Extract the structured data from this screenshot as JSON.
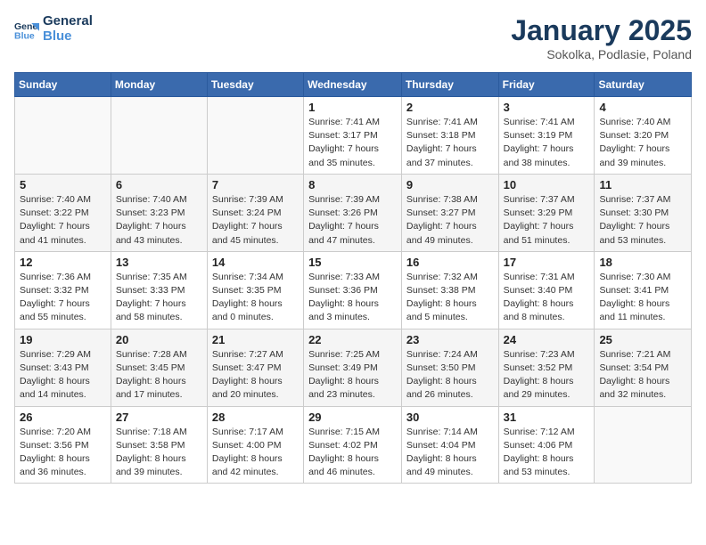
{
  "header": {
    "logo_line1": "General",
    "logo_line2": "Blue",
    "title": "January 2025",
    "subtitle": "Sokolka, Podlasie, Poland"
  },
  "weekdays": [
    "Sunday",
    "Monday",
    "Tuesday",
    "Wednesday",
    "Thursday",
    "Friday",
    "Saturday"
  ],
  "weeks": [
    [
      {
        "day": "",
        "info": ""
      },
      {
        "day": "",
        "info": ""
      },
      {
        "day": "",
        "info": ""
      },
      {
        "day": "1",
        "info": "Sunrise: 7:41 AM\nSunset: 3:17 PM\nDaylight: 7 hours and 35 minutes."
      },
      {
        "day": "2",
        "info": "Sunrise: 7:41 AM\nSunset: 3:18 PM\nDaylight: 7 hours and 37 minutes."
      },
      {
        "day": "3",
        "info": "Sunrise: 7:41 AM\nSunset: 3:19 PM\nDaylight: 7 hours and 38 minutes."
      },
      {
        "day": "4",
        "info": "Sunrise: 7:40 AM\nSunset: 3:20 PM\nDaylight: 7 hours and 39 minutes."
      }
    ],
    [
      {
        "day": "5",
        "info": "Sunrise: 7:40 AM\nSunset: 3:22 PM\nDaylight: 7 hours and 41 minutes."
      },
      {
        "day": "6",
        "info": "Sunrise: 7:40 AM\nSunset: 3:23 PM\nDaylight: 7 hours and 43 minutes."
      },
      {
        "day": "7",
        "info": "Sunrise: 7:39 AM\nSunset: 3:24 PM\nDaylight: 7 hours and 45 minutes."
      },
      {
        "day": "8",
        "info": "Sunrise: 7:39 AM\nSunset: 3:26 PM\nDaylight: 7 hours and 47 minutes."
      },
      {
        "day": "9",
        "info": "Sunrise: 7:38 AM\nSunset: 3:27 PM\nDaylight: 7 hours and 49 minutes."
      },
      {
        "day": "10",
        "info": "Sunrise: 7:37 AM\nSunset: 3:29 PM\nDaylight: 7 hours and 51 minutes."
      },
      {
        "day": "11",
        "info": "Sunrise: 7:37 AM\nSunset: 3:30 PM\nDaylight: 7 hours and 53 minutes."
      }
    ],
    [
      {
        "day": "12",
        "info": "Sunrise: 7:36 AM\nSunset: 3:32 PM\nDaylight: 7 hours and 55 minutes."
      },
      {
        "day": "13",
        "info": "Sunrise: 7:35 AM\nSunset: 3:33 PM\nDaylight: 7 hours and 58 minutes."
      },
      {
        "day": "14",
        "info": "Sunrise: 7:34 AM\nSunset: 3:35 PM\nDaylight: 8 hours and 0 minutes."
      },
      {
        "day": "15",
        "info": "Sunrise: 7:33 AM\nSunset: 3:36 PM\nDaylight: 8 hours and 3 minutes."
      },
      {
        "day": "16",
        "info": "Sunrise: 7:32 AM\nSunset: 3:38 PM\nDaylight: 8 hours and 5 minutes."
      },
      {
        "day": "17",
        "info": "Sunrise: 7:31 AM\nSunset: 3:40 PM\nDaylight: 8 hours and 8 minutes."
      },
      {
        "day": "18",
        "info": "Sunrise: 7:30 AM\nSunset: 3:41 PM\nDaylight: 8 hours and 11 minutes."
      }
    ],
    [
      {
        "day": "19",
        "info": "Sunrise: 7:29 AM\nSunset: 3:43 PM\nDaylight: 8 hours and 14 minutes."
      },
      {
        "day": "20",
        "info": "Sunrise: 7:28 AM\nSunset: 3:45 PM\nDaylight: 8 hours and 17 minutes."
      },
      {
        "day": "21",
        "info": "Sunrise: 7:27 AM\nSunset: 3:47 PM\nDaylight: 8 hours and 20 minutes."
      },
      {
        "day": "22",
        "info": "Sunrise: 7:25 AM\nSunset: 3:49 PM\nDaylight: 8 hours and 23 minutes."
      },
      {
        "day": "23",
        "info": "Sunrise: 7:24 AM\nSunset: 3:50 PM\nDaylight: 8 hours and 26 minutes."
      },
      {
        "day": "24",
        "info": "Sunrise: 7:23 AM\nSunset: 3:52 PM\nDaylight: 8 hours and 29 minutes."
      },
      {
        "day": "25",
        "info": "Sunrise: 7:21 AM\nSunset: 3:54 PM\nDaylight: 8 hours and 32 minutes."
      }
    ],
    [
      {
        "day": "26",
        "info": "Sunrise: 7:20 AM\nSunset: 3:56 PM\nDaylight: 8 hours and 36 minutes."
      },
      {
        "day": "27",
        "info": "Sunrise: 7:18 AM\nSunset: 3:58 PM\nDaylight: 8 hours and 39 minutes."
      },
      {
        "day": "28",
        "info": "Sunrise: 7:17 AM\nSunset: 4:00 PM\nDaylight: 8 hours and 42 minutes."
      },
      {
        "day": "29",
        "info": "Sunrise: 7:15 AM\nSunset: 4:02 PM\nDaylight: 8 hours and 46 minutes."
      },
      {
        "day": "30",
        "info": "Sunrise: 7:14 AM\nSunset: 4:04 PM\nDaylight: 8 hours and 49 minutes."
      },
      {
        "day": "31",
        "info": "Sunrise: 7:12 AM\nSunset: 4:06 PM\nDaylight: 8 hours and 53 minutes."
      },
      {
        "day": "",
        "info": ""
      }
    ]
  ]
}
